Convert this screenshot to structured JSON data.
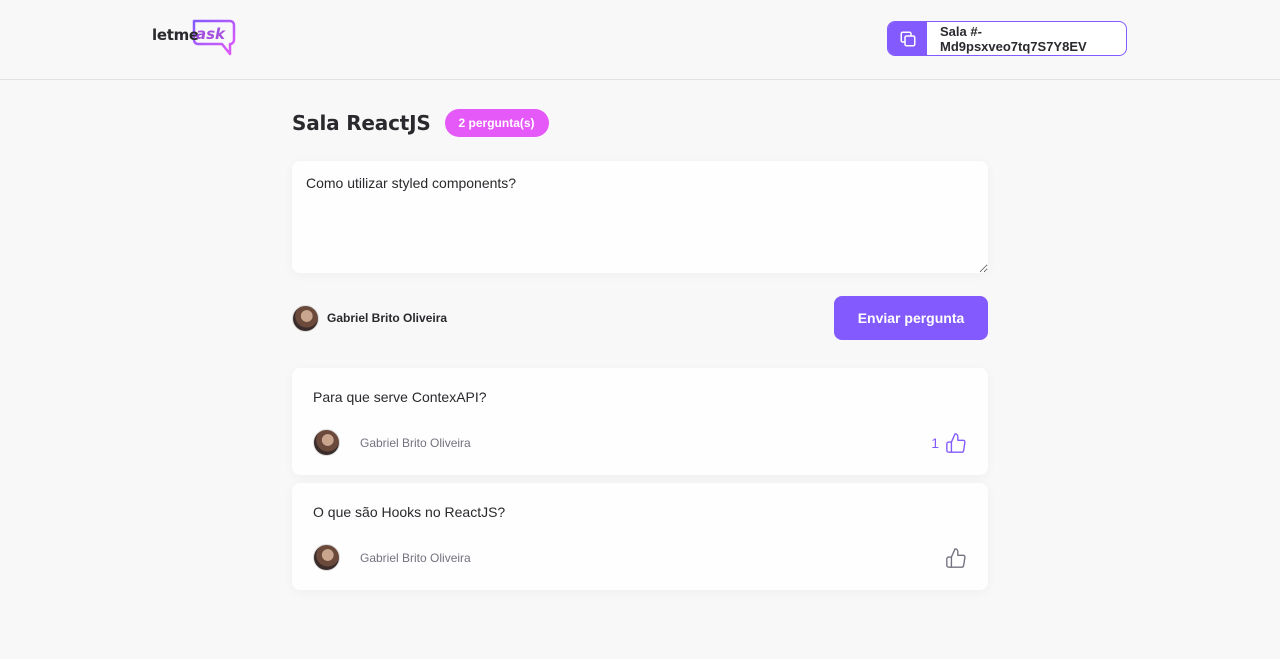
{
  "header": {
    "logo": {
      "prefix": "letme",
      "suffix": "ask"
    },
    "room_code": "Sala #-Md9psxveo7tq7S7Y8EV"
  },
  "room": {
    "title": "Sala ReactJS",
    "question_count_badge": "2 pergunta(s)"
  },
  "form": {
    "textarea_value": "Como utilizar styled components?",
    "user_name": "Gabriel Brito Oliveira",
    "submit_label": "Enviar pergunta"
  },
  "questions": [
    {
      "content": "Para que serve ContexAPI?",
      "author": "Gabriel Brito Oliveira",
      "like_count": "1",
      "liked": true
    },
    {
      "content": "O que são Hooks no ReactJS?",
      "author": "Gabriel Brito Oliveira",
      "like_count": "",
      "liked": false
    }
  ],
  "colors": {
    "primary": "#835afd",
    "badge": "#e559f9",
    "text": "#29292e",
    "muted": "#737380",
    "background": "#f8f8f8"
  },
  "icons": {
    "copy": "copy-icon",
    "like": "thumbs-up-icon"
  }
}
